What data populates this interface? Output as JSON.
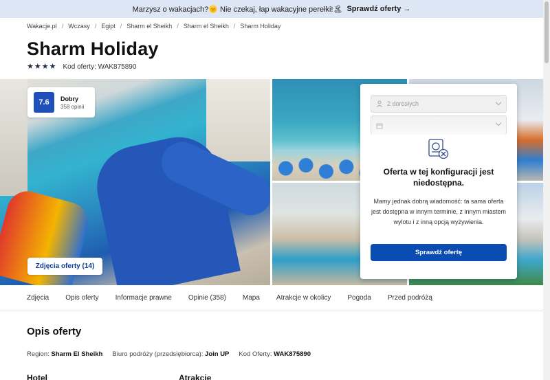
{
  "promo": {
    "text": "Marzysz o wakacjach?🌞 Nie czekaj, łap wakacyjne perełki!🏝",
    "cta": "Sprawdź oferty →"
  },
  "breadcrumb": [
    "Wakacje.pl",
    "Wczasy",
    "Egipt",
    "Sharm el Sheikh",
    "Sharm el Sheikh",
    "Sharm Holiday"
  ],
  "hotel": {
    "name": "Sharm Holiday",
    "stars": 4,
    "offer_code_label": "Kod oferty: WAK875890"
  },
  "rating": {
    "score": "7.6",
    "label": "Dobry",
    "count": "358 opinii"
  },
  "gallery": {
    "photos_button": "Zdjęcia oferty (14)"
  },
  "offer_panel": {
    "guests_value": "2 dorosłych",
    "date_value": "",
    "unavailable_title": "Oferta w tej konfiguracji jest niedostępna.",
    "unavailable_text": "Mamy jednak dobrą wiadomość: ta sama oferta jest dostępna w innym terminie, z innym miastem wylotu i z inną opcją wyżywienia.",
    "check_button": "Sprawdź ofertę"
  },
  "tabs": [
    "Zdjęcia",
    "Opis oferty",
    "Informacje prawne",
    "Opinie (358)",
    "Mapa",
    "Atrakcje w okolicy",
    "Pogoda",
    "Przed podróżą"
  ],
  "description": {
    "title": "Opis oferty",
    "region_label": "Region:",
    "region_value": "Sharm El Sheikh",
    "operator_label": "Biuro podróży (przedsiębiorca):",
    "operator_value": "Join UP",
    "code_label": "Kod Oferty:",
    "code_value": "WAK875890",
    "hotel_heading": "Hotel",
    "attractions_heading": "Atrakcje"
  },
  "colors": {
    "accent": "#0b4cb3",
    "promo_bg": "#dde6f5",
    "score_bg": "#1f4fb8"
  }
}
